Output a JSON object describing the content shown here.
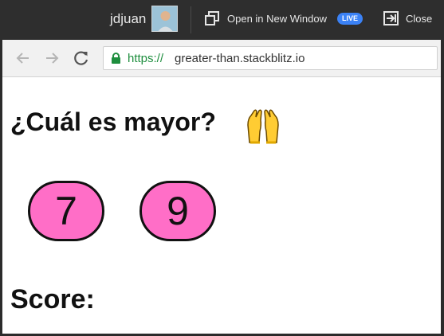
{
  "topbar": {
    "user_name": "jdjuan",
    "open_label": "Open in New Window",
    "live_badge": "LIVE",
    "close_label": "Close"
  },
  "browser": {
    "url_scheme": "https://",
    "url_host": "greater-than.stackblitz.io"
  },
  "page": {
    "title": "¿Cuál es mayor?",
    "emoji": "raised-hands-icon",
    "numbers": [
      "7",
      "9"
    ],
    "score_label": "Score:"
  },
  "colors": {
    "number_button": "#ff6ec7",
    "live_badge": "#3b82f6",
    "secure_url": "#1e8e3e"
  }
}
